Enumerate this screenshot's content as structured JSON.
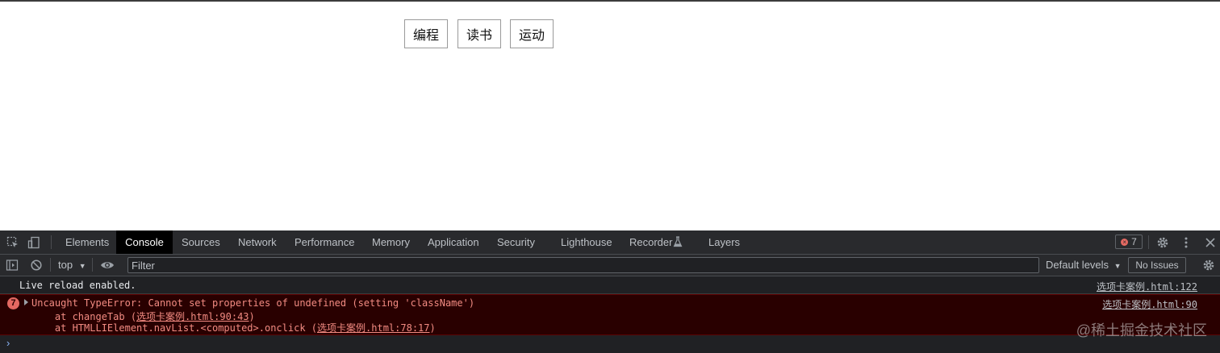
{
  "page": {
    "buttons": [
      {
        "label": "编程"
      },
      {
        "label": "读书"
      },
      {
        "label": "运动"
      }
    ]
  },
  "devtools": {
    "tabs": [
      "Elements",
      "Console",
      "Sources",
      "Network",
      "Performance",
      "Memory",
      "Application",
      "Security",
      "Lighthouse",
      "Recorder",
      "Layers"
    ],
    "active_tab": "Console",
    "error_count": "7",
    "toolbar": {
      "context": "top",
      "filter_placeholder": "Filter",
      "levels": "Default levels",
      "issues": "No Issues"
    },
    "messages": {
      "info": {
        "text": "Live reload enabled.",
        "source": "选项卡案例.html:122"
      },
      "error": {
        "count": "7",
        "message": "Uncaught TypeError: Cannot set properties of undefined (setting 'className')",
        "source": "选项卡案例.html:90",
        "stack": [
          {
            "prefix": "    at changeTab (",
            "link": "选项卡案例.html:90:43",
            "suffix": ")"
          },
          {
            "prefix": "    at HTMLLIElement.navList.<computed>.onclick (",
            "link": "选项卡案例.html:78:17",
            "suffix": ")"
          }
        ]
      }
    }
  },
  "watermark": "@稀土掘金技术社区",
  "colors": {
    "devtools_bg": "#202124",
    "error_bg": "#290000",
    "error_text": "#f28b82"
  },
  "icons": [
    "inspect-element-icon",
    "device-toggle-icon",
    "recorder-flask-icon",
    "settings-gear-icon",
    "more-vertical-icon",
    "close-icon",
    "sidebar-toggle-icon",
    "clear-console-icon",
    "live-expression-eye-icon",
    "console-settings-gear-icon",
    "prompt-chevron-icon"
  ]
}
